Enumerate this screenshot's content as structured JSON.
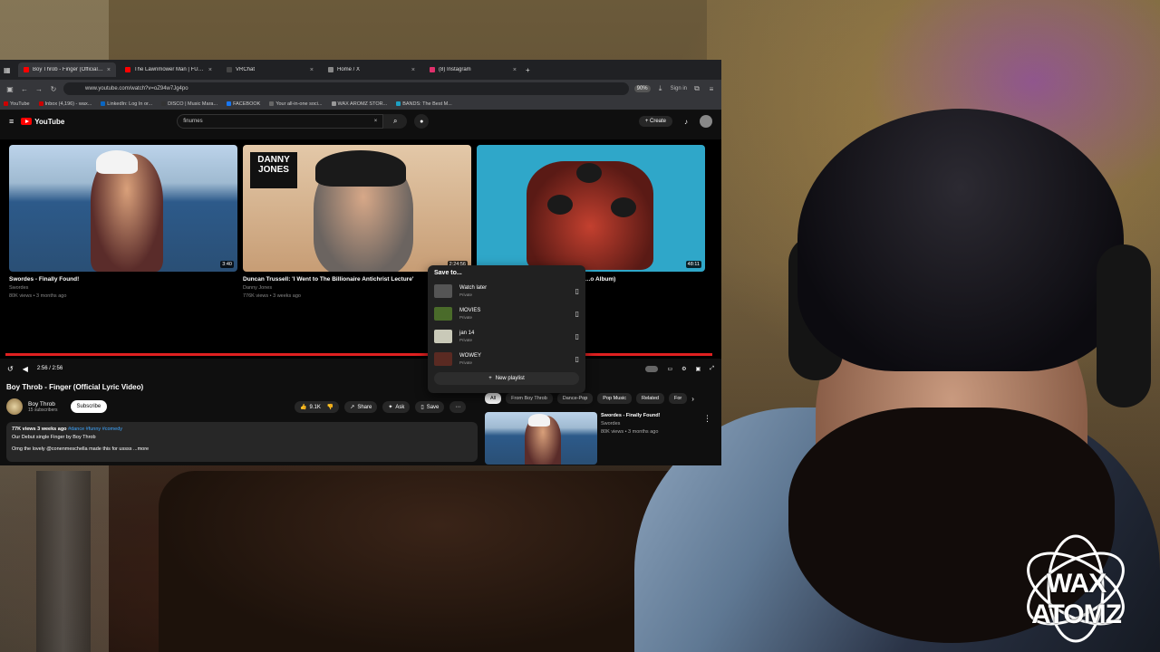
{
  "browser": {
    "tabs": [
      {
        "title": "Boy Throb - Finger (Official Lyric",
        "color": "#ff0000",
        "active": true
      },
      {
        "title": "The Lawnmower Man | FULL M",
        "color": "#ff0000",
        "active": false
      },
      {
        "title": "VRChat",
        "color": "#444444",
        "active": false
      },
      {
        "title": "Home / X",
        "color": "#888888",
        "active": false
      },
      {
        "title": "(8) Instagram",
        "color": "#e1306c",
        "active": false
      }
    ],
    "url": "www.youtube.com/watch?v=oZ94w7Jg4po",
    "zoom": "90%",
    "sign_in": "Sign in",
    "bookmarks": [
      "YouTube",
      "Inbox (4,196) - wax...",
      "LinkedIn: Log In or...",
      "DISCO | Music Mara...",
      "FACEBOOK",
      "Your all-in-one soci...",
      "WAX AROMZ STOR...",
      "BANDS: The Best M..."
    ]
  },
  "youtube": {
    "logo": "YouTube",
    "search_query": "finurnes",
    "create": "Create"
  },
  "end_screen": [
    {
      "title": "Swordes - Finally Found!",
      "channel": "Swordes",
      "meta": "80K views • 3 months ago",
      "duration": "3:40"
    },
    {
      "title": "Duncan Trussell: 'I Went to The Billionaire Antichrist Lecture'",
      "channel": "Danny Jones",
      "meta": "776K views • 3 weeks ago",
      "duration": "2:24:56",
      "brand": "DANNY JONES"
    },
    {
      "title": "...o Album)",
      "channel": "",
      "meta": "",
      "duration": "48:11"
    }
  ],
  "player": {
    "time": "2:56 / 2:56"
  },
  "video": {
    "title": "Boy Throb - Finger (Official Lyric Video)",
    "channel": "Boy Throb",
    "subscribers": "15 subscribers",
    "subscribe": "Subscribe",
    "likes": "9.1K",
    "share": "Share",
    "ask": "Ask",
    "save": "Save",
    "stats": "77K views  3 weeks ago",
    "tags": "#dance #funny #comedy",
    "desc_line1": "Our Debut single Finger by Boy Throb",
    "desc_line2": "Omg the lovely @conenmeschella made this for ussss",
    "more": "...more"
  },
  "chips": [
    "All",
    "From Boy Throb",
    "Dance-Pop",
    "Pop Music",
    "Related",
    "For"
  ],
  "recommended": {
    "title": "Swordes - Finally Found!",
    "channel": "Swordes",
    "meta": "80K views • 3 months ago"
  },
  "save_dialog": {
    "header": "Save to...",
    "playlists": [
      {
        "name": "Watch later",
        "privacy": "Private",
        "color": "#555555"
      },
      {
        "name": "MOVIES",
        "privacy": "Private",
        "color": "#4a6b2a"
      },
      {
        "name": "jan 14",
        "privacy": "Private",
        "color": "#c9c9b8"
      },
      {
        "name": "WOWEY",
        "privacy": "Private",
        "color": "#5a2a22"
      }
    ],
    "new_playlist": "New playlist"
  },
  "stream_logo": "WAX ATOMZ"
}
